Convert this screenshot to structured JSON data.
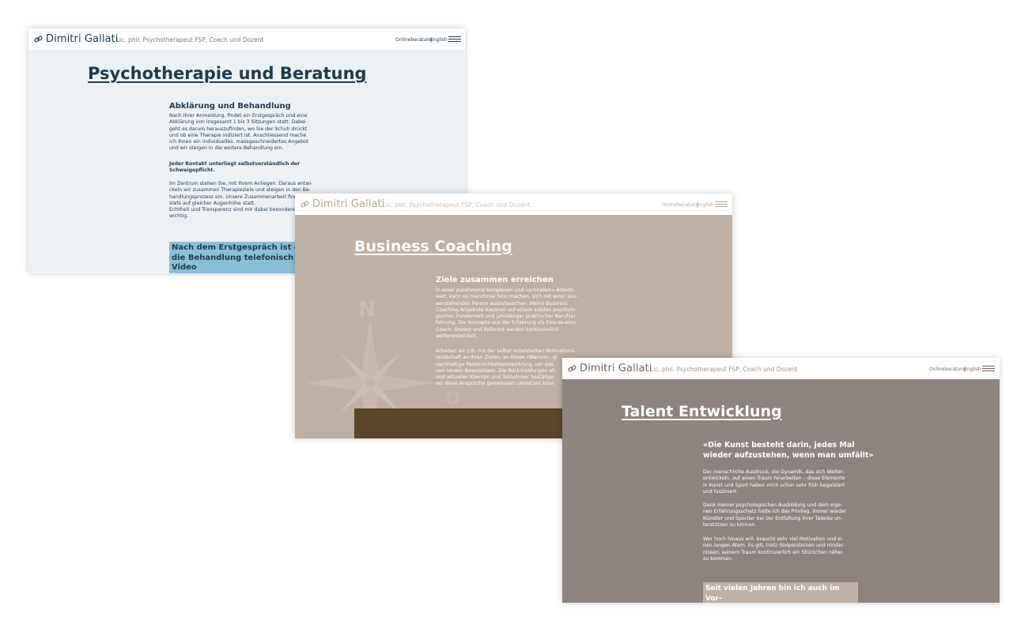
{
  "brand": {
    "name": "Dimitri Gallati",
    "subtitle": "Lic. phil. Psychotherapeut FSP, Coach und Dozent",
    "nav_online": "Onlineberatung",
    "nav_english": "English"
  },
  "colors": {
    "therapy_bg": "#eef1f4",
    "therapy_text": "#1f3a4f",
    "therapy_highlight": "#8bbfd9",
    "coaching_bg": "#bfb0a5",
    "coaching_brown": "#5c4528",
    "talent_bg": "#8d8480",
    "talent_highlight": "#bfb1a6"
  },
  "therapy": {
    "title": "Psychotherapie und Beratung",
    "heading": "Abklärung und Behandlung",
    "p1": "Nach Ihrer Anmeldung, findet ein Erstgespräch und eine\nAbklärung von insgesamt 1 bis 3 Sitzungen statt. Dabei\ngeht es darum herauszufinden, wo Sie der Schuh drückt\nund ob eine Therapie indiziert ist. Anschliessend mache\nich Ihnen ein individuelles, massgeschneidertes Angebot\nund wir steigen in die weitere Behandlung ein.",
    "bold": "Jeder Kontakt unterliegt selbstverständlich der\nSchweigepflicht.",
    "p2": "Im Zentrum stehen Sie, mit Ihrem Anliegen. Daraus entwi-\nckeln wir zusammen Therapieziele und steigen in den Be-\nhandlungsprozess ein. Unsere Zusammenarbeit findet\nstets auf gleicher Augenhöhe statt.\nEchtheit und Transparenz sind mir dabei besonders\nwichtig.",
    "highlight": "Nach dem Erstgespräch ist es möglich,\ndie Behandlung telefonisch oder per Video\nweiterzuführen."
  },
  "coaching": {
    "title": "Business Coaching",
    "heading": "Ziele zusammen erreichen",
    "p1": "In einer zunehmend komplexen und «schnellen» Arbeits-\nwelt, kann es manchmal Sinn machen, sich mit einer aus-\nsenstehenden Person auszutauschen. Meine Business\nCoaching Angebote basieren auf einem soliden psycholo-\ngischen Fundament und jahrelanger praktischer Berufser-\nfahrung. Die Konzepte aus der Erfahrung als Eins-zu-eins-\nCoach, Dozent und Referent werden kontinuierlich\nweiterentwickelt.",
    "p2": "Arbeiten wir z.B. mit der selbst entwickelten Motivations-\nlandschaft an Ihren Zielen, an Ihrem «Warum», gi\nnachhaltige Persönlichkeitsentwicklung, um das\nvon neuem Bewusstsein. Die Rückmeldungen eh\nund aktueller Klienten und Teilnehmer bestätige\nwir diese Ansprüche gemeinsam umsetzen könn",
    "compass_n": "N",
    "compass_o": "O"
  },
  "talent": {
    "title": "Talent Entwicklung",
    "quote": "«Die Kunst besteht darin, jedes Mal\nwieder aufzustehen, wenn man umfällt»",
    "p1": "Der menschliche Ausdruck, die Dynamik, das sich Weiter-\nentwickeln, auf einen Traum hinarbeiten – diese Elemente\nin Kunst und Sport haben mich schon sehr früh begeistert\nund fasziniert.",
    "p2": "Dank meiner psychologischen Ausbildung und dem eige-\nnen Erfahrungsschatz hatte ich das Privileg, immer wieder\nKünstler und Sportler bei der Entfaltung ihrer Talente un-\nterstützen zu können.",
    "p3": "Wer hoch hinaus will, braucht sehr viel Motivation und ei-\nnen langen Atem. Es gilt, trotz Stolpersteinen und Hinder-\nnissen, seinem Traum kontinuierlich ein Stückchen näher\nzu kommen.",
    "highlight": "Seit vielen Jahren bin ich auch im Vor-\nstand des  Vereins TalentCare aktiv."
  }
}
